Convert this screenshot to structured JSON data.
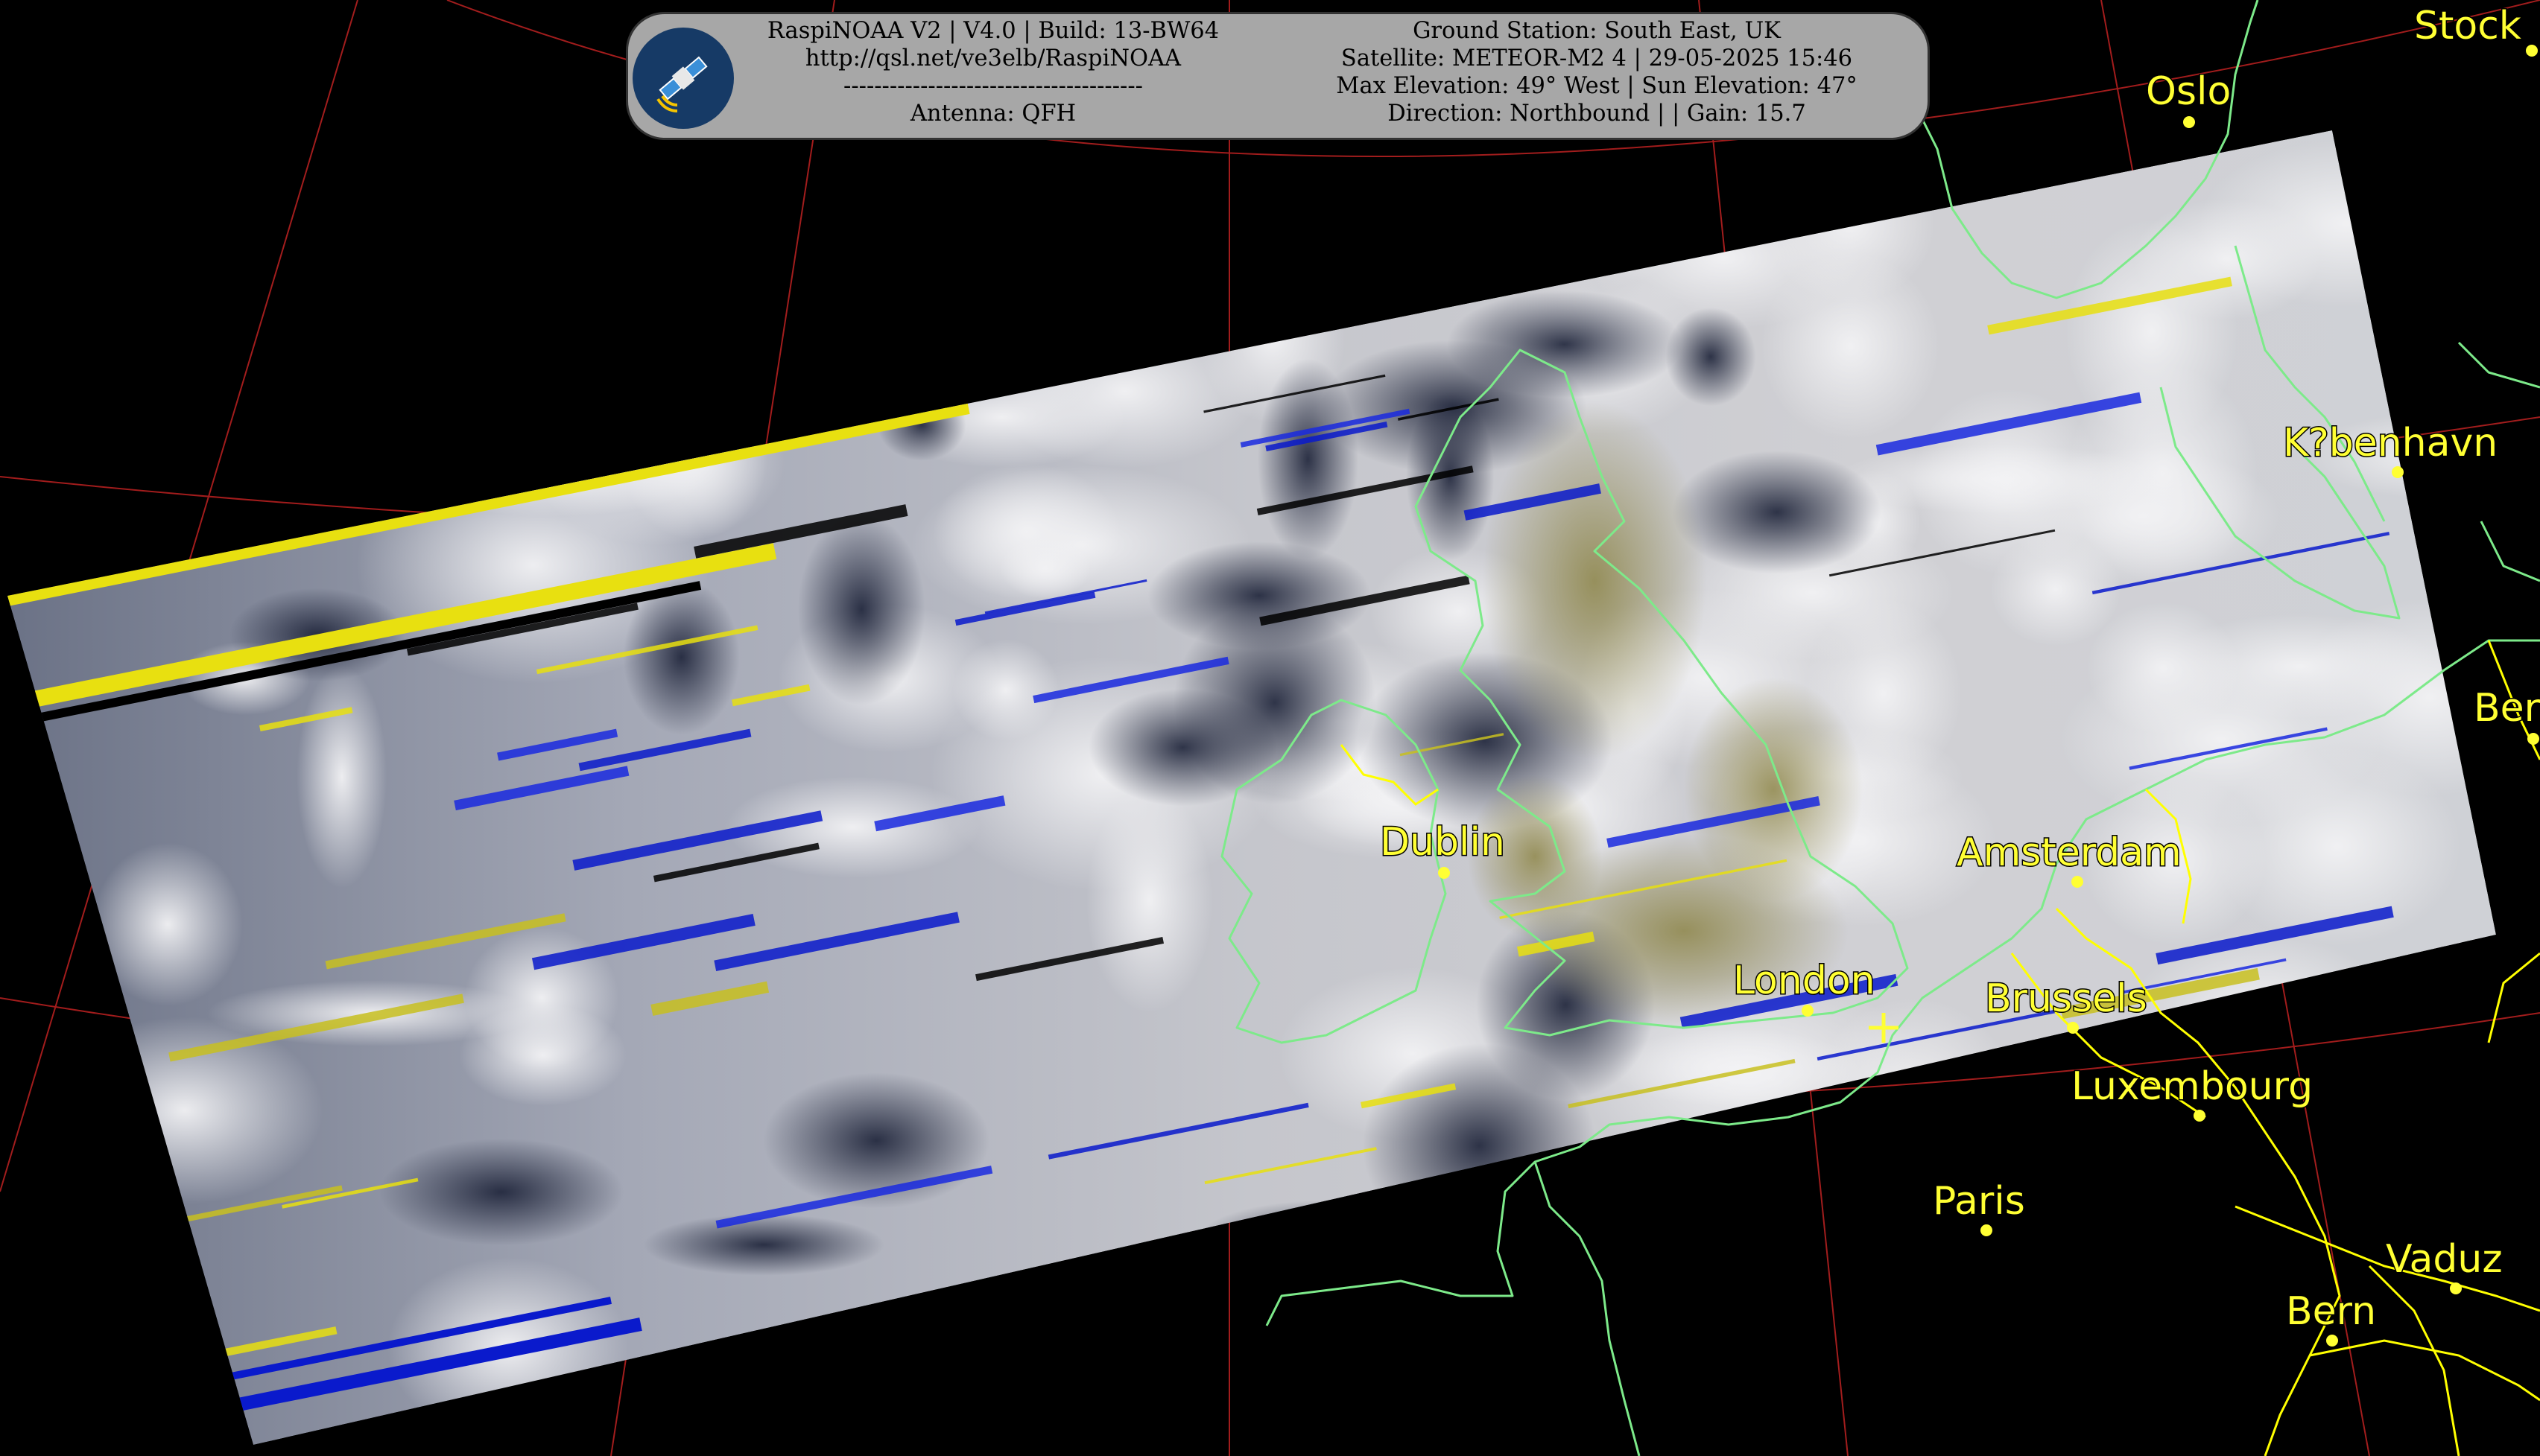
{
  "header": {
    "left_lines": [
      "RaspiNOAA V2 | V4.0 | Build: 13-BW64",
      "http://qsl.net/ve3elb/RaspiNOAA",
      "---------------------------------------",
      "Antenna: QFH"
    ],
    "right_lines": [
      "Ground Station: South East, UK",
      "Satellite: METEOR-M2 4 | 29-05-2025 15:46",
      "Max Elevation: 49° West | Sun Elevation: 47°",
      "Direction: Northbound | | Gain: 15.7"
    ],
    "logo_icon": "satellite-icon"
  },
  "cities": {
    "stockholm": "Stock",
    "oslo": "Oslo",
    "copenhagen": "K?benhavn",
    "berlin": "Ber",
    "dublin": "Dublin",
    "amsterdam": "Amsterdam",
    "london": "London",
    "brussels": "Brussels",
    "luxembourg": "Luxembourg",
    "paris": "Paris",
    "vaduz": "Vaduz",
    "bern": "Bern"
  },
  "colors": {
    "background": "#000000",
    "coastline": "#7dea8a",
    "border": "#ffff00",
    "labels": "#ffff33",
    "graticule": "#b42020",
    "header_bg": "#a7a7a7",
    "noise_blue": "#0a1acc",
    "noise_yellow": "#e8e010"
  }
}
